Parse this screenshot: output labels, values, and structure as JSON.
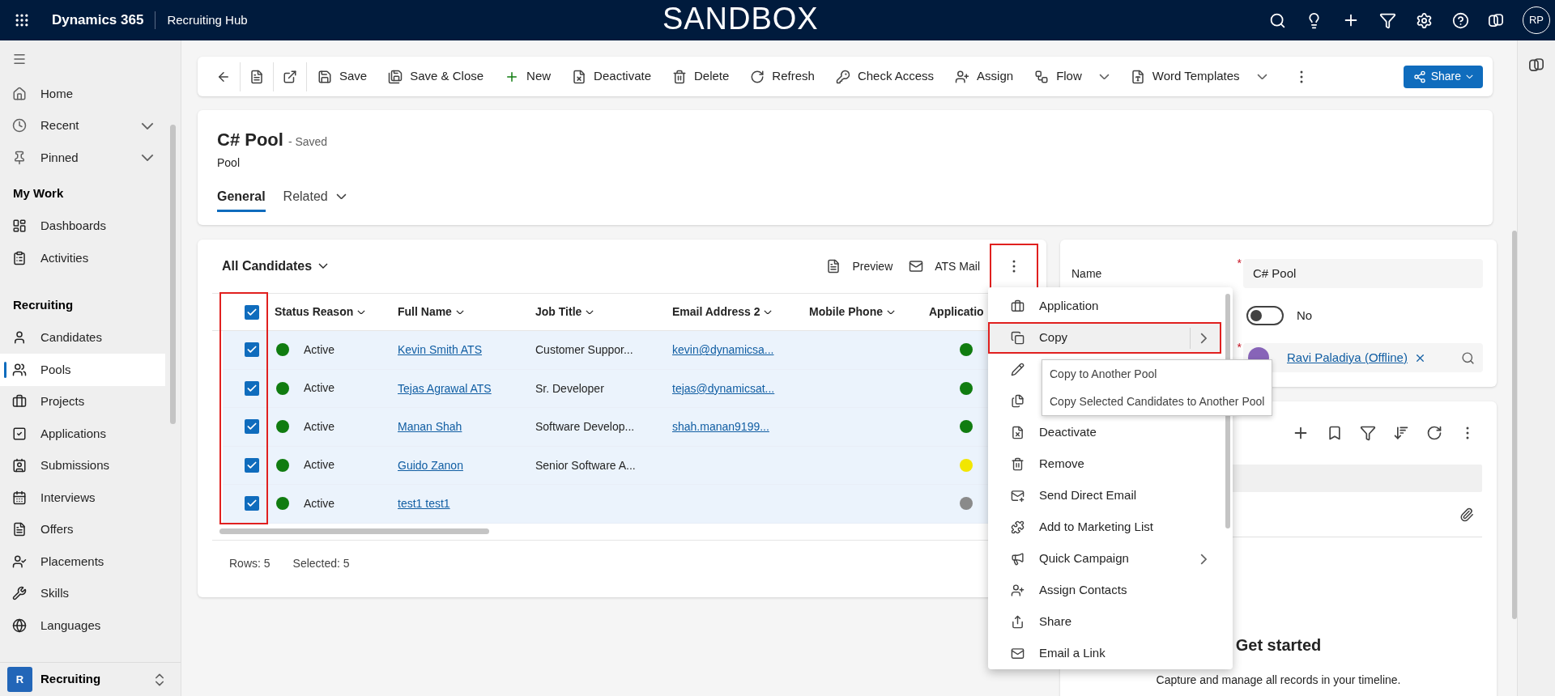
{
  "top_bar": {
    "app_name": "Dynamics 365",
    "area": "Recruiting Hub",
    "environment": "SANDBOX",
    "avatar": "RP"
  },
  "sidebar": {
    "items": [
      {
        "label": "Home",
        "expandable": false
      },
      {
        "label": "Recent",
        "expandable": true
      },
      {
        "label": "Pinned",
        "expandable": true
      }
    ],
    "groups": [
      {
        "title": "My Work",
        "items": [
          {
            "label": "Dashboards",
            "selected": false
          },
          {
            "label": "Activities",
            "selected": false
          }
        ]
      },
      {
        "title": "Recruiting",
        "items": [
          {
            "label": "Candidates",
            "selected": false
          },
          {
            "label": "Pools",
            "selected": true
          },
          {
            "label": "Projects",
            "selected": false
          },
          {
            "label": "Applications",
            "selected": false
          },
          {
            "label": "Submissions",
            "selected": false
          },
          {
            "label": "Interviews",
            "selected": false
          },
          {
            "label": "Offers",
            "selected": false
          },
          {
            "label": "Placements",
            "selected": false
          },
          {
            "label": "Skills",
            "selected": false
          },
          {
            "label": "Languages",
            "selected": false
          }
        ]
      }
    ],
    "area_switcher": {
      "badge": "R",
      "label": "Recruiting"
    }
  },
  "command_bar": {
    "items": [
      {
        "kind": "icon"
      },
      {
        "kind": "icon"
      },
      {
        "kind": "icon"
      },
      {
        "kind": "button",
        "label": "Save",
        "has_menu": false
      },
      {
        "kind": "button",
        "label": "Save & Close",
        "has_menu": false
      },
      {
        "kind": "button",
        "label": "New",
        "has_menu": false
      },
      {
        "kind": "button",
        "label": "Deactivate",
        "has_menu": false
      },
      {
        "kind": "button",
        "label": "Delete",
        "has_menu": false
      },
      {
        "kind": "button",
        "label": "Refresh",
        "has_menu": false
      },
      {
        "kind": "button",
        "label": "Check Access",
        "has_menu": false
      },
      {
        "kind": "button",
        "label": "Assign",
        "has_menu": false
      },
      {
        "kind": "button",
        "label": "Flow",
        "has_menu": true
      },
      {
        "kind": "button",
        "label": "Word Templates",
        "has_menu": true
      },
      {
        "kind": "more"
      }
    ],
    "share": {
      "label": "Share"
    }
  },
  "record": {
    "title": "C# Pool",
    "status": "- Saved",
    "entity": "Pool",
    "tabs": [
      {
        "label": "General",
        "selected": true,
        "has_menu": false
      },
      {
        "label": "Related",
        "selected": false,
        "has_menu": true
      }
    ]
  },
  "subgrid": {
    "view": "All Candidates",
    "actions": [
      {
        "label": "Preview"
      },
      {
        "label": "ATS Mail"
      }
    ],
    "more_highlighted": true,
    "checkbox_column_highlighted": true,
    "select_all": {
      "checked": true
    },
    "columns": [
      "Status Reason",
      "Full Name",
      "Job Title",
      "Email Address 2",
      "Mobile Phone",
      "Applicatio"
    ],
    "rows": [
      {
        "selected": true,
        "status": {
          "text": "Active",
          "color": "#107c10"
        },
        "full_name": "Kevin Smith ATS",
        "job_title": "Customer Suppor...",
        "email": "kevin@dynamicsa...",
        "application": {
          "color": "#107c10"
        }
      },
      {
        "selected": true,
        "status": {
          "text": "Active",
          "color": "#107c10"
        },
        "full_name": "Tejas Agrawal ATS",
        "job_title": "Sr. Developer",
        "email": "tejas@dynamicsat...",
        "application": {
          "color": "#107c10"
        }
      },
      {
        "selected": true,
        "status": {
          "text": "Active",
          "color": "#107c10"
        },
        "full_name": "Manan Shah",
        "job_title": "Software Develop...",
        "email": "shah.manan9199...",
        "application": {
          "color": "#107c10"
        }
      },
      {
        "selected": true,
        "status": {
          "text": "Active",
          "color": "#107c10"
        },
        "full_name": "Guido Zanon",
        "job_title": "Senior Software A...",
        "application": {
          "color": "#f2e600"
        }
      },
      {
        "selected": true,
        "status": {
          "text": "Active",
          "color": "#107c10"
        },
        "full_name": "test1 test1",
        "application": {
          "color": "#8a8a8a"
        }
      }
    ],
    "footer": {
      "rows": "Rows: 5",
      "selected": "Selected: 5"
    }
  },
  "form_fields": [
    {
      "kind": "text",
      "label": "Name",
      "required_mark": "*",
      "value": "C# Pool"
    },
    {
      "kind": "toggle",
      "on": false,
      "value": "No"
    },
    {
      "kind": "lookup",
      "required_mark": "*",
      "value": "Ravi Paladiya (Offline)"
    }
  ],
  "timeline": {
    "title": "Get started",
    "description": "Capture and manage all records in your timeline."
  },
  "context_menu": {
    "items": [
      {
        "label": "Application",
        "selected": false,
        "has_submenu": false
      },
      {
        "label": "Copy",
        "selected": true,
        "has_submenu": true,
        "highlighted": true
      },
      {
        "selected": false
      },
      {
        "selected": false
      },
      {
        "label": "Deactivate",
        "selected": false,
        "has_submenu": false
      },
      {
        "label": "Remove",
        "selected": false,
        "has_submenu": false
      },
      {
        "label": "Send Direct Email",
        "selected": false,
        "has_submenu": false
      },
      {
        "label": "Add to Marketing List",
        "selected": false,
        "has_submenu": false
      },
      {
        "label": "Quick Campaign",
        "selected": false,
        "has_submenu": true
      },
      {
        "label": "Assign Contacts",
        "selected": false,
        "has_submenu": false
      },
      {
        "label": "Share",
        "selected": false,
        "has_submenu": false
      },
      {
        "label": "Email a Link",
        "selected": false,
        "has_submenu": false
      }
    ]
  },
  "submenu": {
    "items": [
      "Copy to Another Pool",
      "Copy Selected Candidates to Another Pool"
    ]
  }
}
